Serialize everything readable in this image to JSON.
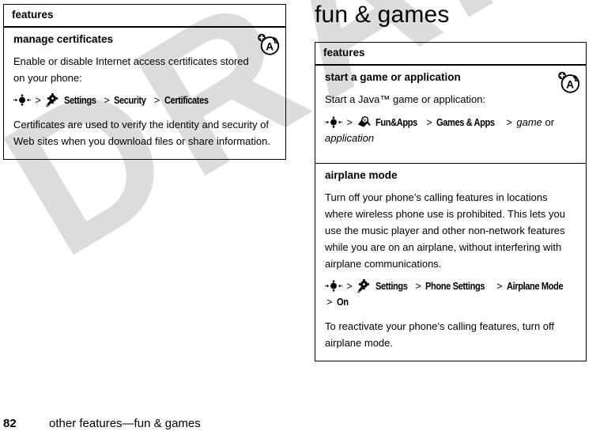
{
  "document": {
    "watermark": "DRAFT"
  },
  "footer": {
    "page_number": "82",
    "breadcrumb": "other features—fun & games"
  },
  "section": {
    "heading": "fun & games"
  },
  "left_table": {
    "header": "features",
    "badge_icon": "browser-alert-icon",
    "rows": [
      {
        "title": "manage certificates",
        "paragraph1": "Enable or disable Internet access certificates stored on your phone:",
        "nav_path": {
          "key_icon": "navigation-key-icon",
          "separator": ">",
          "menu_icon": "settings-gear-icon",
          "items": [
            "Settings",
            "Security",
            "Certificates"
          ]
        },
        "paragraph2": "Certificates are used to verify the identity and security of Web sites when you download files or share information."
      }
    ]
  },
  "right_table": {
    "header": "features",
    "badge_icon": "browser-alert-icon",
    "rows": [
      {
        "title": "start a game or application",
        "paragraph1": "Start a Java™ game or application:",
        "nav_path": {
          "key_icon": "navigation-key-icon",
          "separator": ">",
          "menu_icon": "fun-and-apps-icon",
          "items": [
            "Fun&Apps",
            "Games & Apps"
          ],
          "italic_tail": "game",
          "plain_tail": " or ",
          "italic_tail2": "application"
        }
      },
      {
        "title": "airplane mode",
        "paragraph1": "Turn off your phone’s calling features in locations where wireless phone use is prohibited. This lets you use the music player and other non-network features while you are on an airplane, without interfering with airplane communications.",
        "nav_path": {
          "key_icon": "navigation-key-icon",
          "separator": ">",
          "menu_icon": "settings-gear-icon",
          "items": [
            "Settings",
            "Phone Settings",
            "Airplane Mode",
            "On"
          ]
        },
        "paragraph2": "To reactivate your phone’s calling features, turn off airplane mode."
      }
    ]
  },
  "colors": {
    "ink": "#000000",
    "watermark": "#dcdcdc",
    "page": "#ffffff"
  }
}
